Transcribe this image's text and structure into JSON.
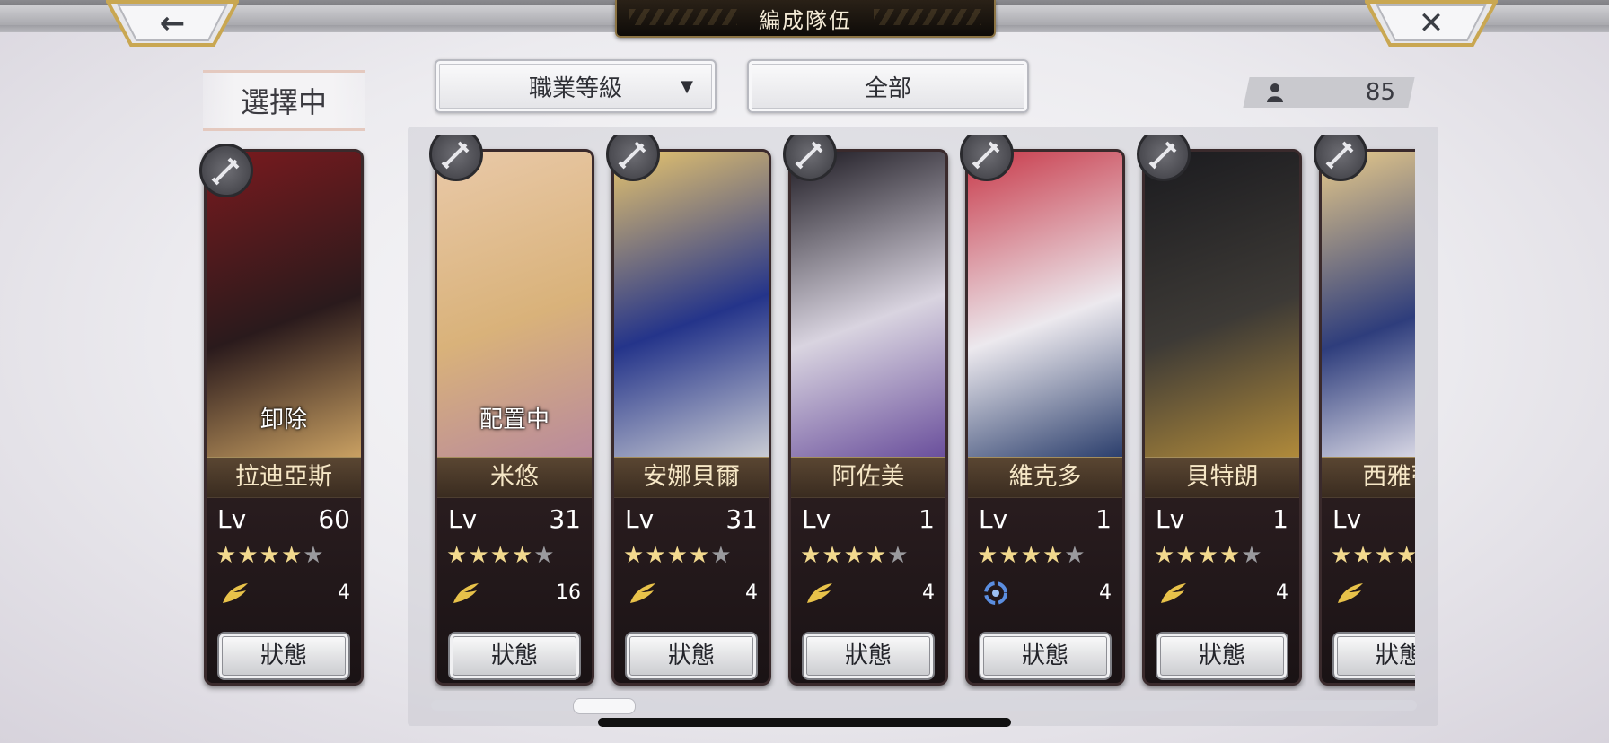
{
  "header": {
    "title": "編成隊伍",
    "back_icon": "arrow-left-icon",
    "close_icon": "close-x-icon"
  },
  "selection": {
    "label": "選擇中",
    "card": {
      "name": "拉迪亞斯",
      "overlay": "卸除",
      "lv_label": "Lv",
      "level": "60",
      "stars": 4,
      "max_stars": 5,
      "affinity_icon": "feather-icon",
      "affinity": "4",
      "status_label": "狀態",
      "class_icon": "sword-icon",
      "colors": [
        "#7a1a1e",
        "#2a1a1c",
        "#c9a062"
      ]
    }
  },
  "toolbar": {
    "sort_label": "職業等級",
    "sort_caret": "▼",
    "filter_label": "全部",
    "count_icon": "person-icon",
    "count": "85"
  },
  "roster": [
    {
      "name": "米悠",
      "overlay": "配置中",
      "lv_label": "Lv",
      "level": "31",
      "stars": 4,
      "affinity_icon": "feather-icon",
      "affinity": "16",
      "status_label": "狀態",
      "class_icon": "sword-icon",
      "colors": [
        "#e9c9a8",
        "#d9b27a",
        "#b98a9c"
      ]
    },
    {
      "name": "安娜貝爾",
      "overlay": "",
      "lv_label": "Lv",
      "level": "31",
      "stars": 4,
      "affinity_icon": "feather-icon",
      "affinity": "4",
      "status_label": "狀態",
      "class_icon": "sword-icon",
      "colors": [
        "#e6c46e",
        "#24348a",
        "#c9cbd3"
      ]
    },
    {
      "name": "阿佐美",
      "overlay": "",
      "lv_label": "Lv",
      "level": "1",
      "stars": 4,
      "affinity_icon": "feather-icon",
      "affinity": "4",
      "status_label": "狀態",
      "class_icon": "katana-icon",
      "colors": [
        "#1d1a22",
        "#d9d4e0",
        "#6a4f9c"
      ]
    },
    {
      "name": "維克多",
      "overlay": "",
      "lv_label": "Lv",
      "level": "1",
      "stars": 4,
      "affinity_icon": "swirl-icon",
      "affinity": "4",
      "status_label": "狀態",
      "class_icon": "katana-icon",
      "colors": [
        "#c83a4a",
        "#ece9ee",
        "#2c3f6d"
      ]
    },
    {
      "name": "貝特朗",
      "overlay": "",
      "lv_label": "Lv",
      "level": "1",
      "stars": 4,
      "affinity_icon": "feather-icon",
      "affinity": "4",
      "status_label": "狀態",
      "class_icon": "spear-icon",
      "colors": [
        "#1b1b1f",
        "#3d3a36",
        "#b08a3a"
      ]
    },
    {
      "name": "西雅蒂",
      "overlay": "",
      "lv_label": "Lv",
      "level": "",
      "stars": 4,
      "affinity_icon": "feather-icon",
      "affinity": "",
      "status_label": "狀態",
      "class_icon": "bow-icon",
      "colors": [
        "#e6c98a",
        "#2e3d7c",
        "#f1eef4"
      ]
    }
  ],
  "scroll": {
    "position": 0.15
  }
}
